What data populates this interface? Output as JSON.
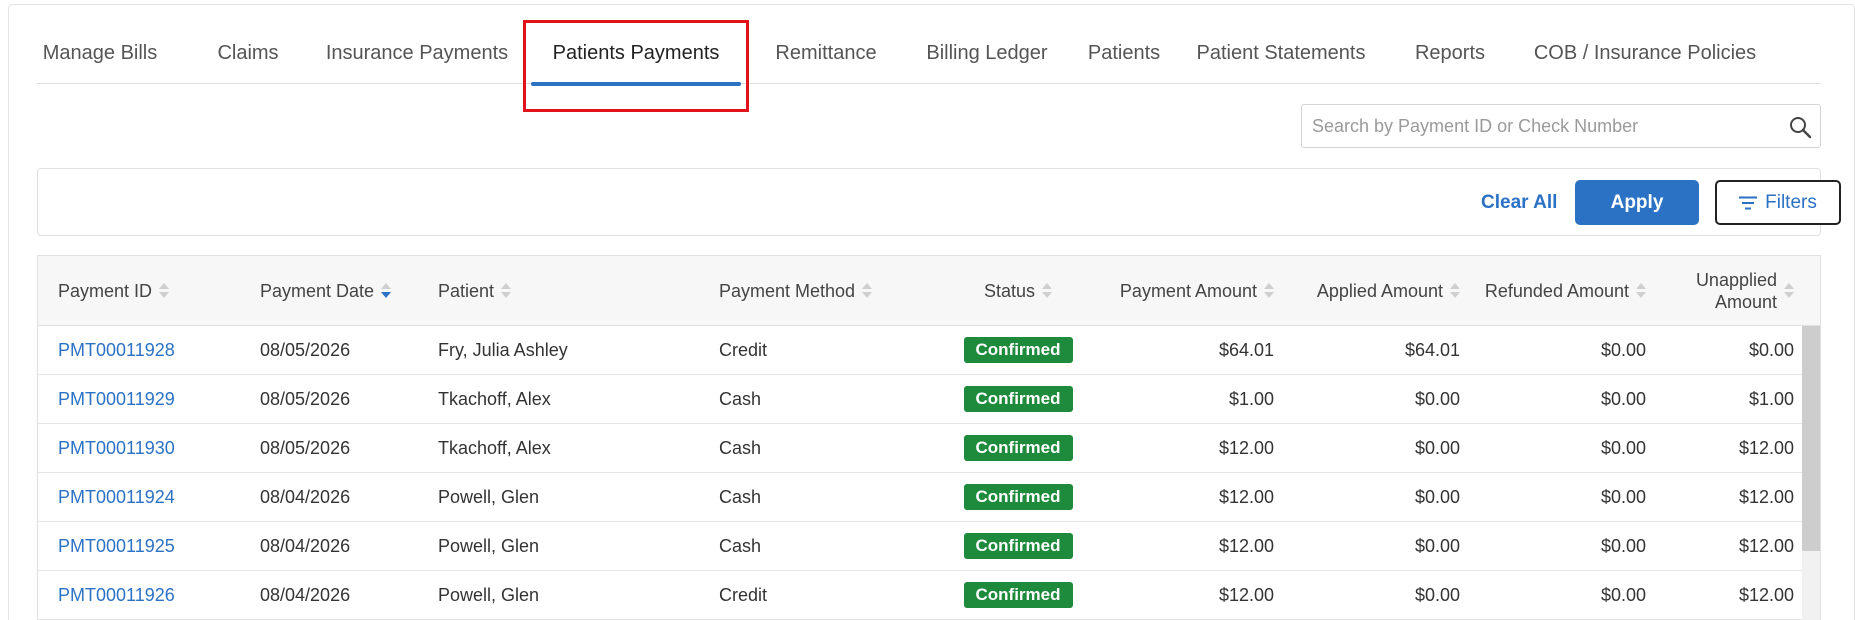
{
  "tabs": [
    {
      "label": "Manage Bills"
    },
    {
      "label": "Claims"
    },
    {
      "label": "Insurance Payments"
    },
    {
      "label": "Patients Payments",
      "active": true
    },
    {
      "label": "Remittance"
    },
    {
      "label": "Billing Ledger"
    },
    {
      "label": "Patients"
    },
    {
      "label": "Patient Statements"
    },
    {
      "label": "Reports"
    },
    {
      "label": "COB / Insurance Policies"
    }
  ],
  "search": {
    "placeholder": "Search by Payment ID or Check Number",
    "value": "",
    "icon": "search-icon"
  },
  "filterbar": {
    "clear_label": "Clear All",
    "apply_label": "Apply",
    "filters_label": "Filters",
    "filters_icon": "filter-lines-icon"
  },
  "table": {
    "columns": [
      {
        "label": "Payment ID",
        "sort": "none"
      },
      {
        "label": "Payment Date",
        "sort": "desc"
      },
      {
        "label": "Patient",
        "sort": "none"
      },
      {
        "label": "Payment Method",
        "sort": "none"
      },
      {
        "label": "Status",
        "sort": "none"
      },
      {
        "label": "Payment Amount",
        "sort": "none"
      },
      {
        "label": "Applied Amount",
        "sort": "none"
      },
      {
        "label": "Refunded Amount",
        "sort": "none"
      },
      {
        "label": "Unapplied Amount",
        "label_line1": "Unapplied",
        "label_line2": "Amount",
        "sort": "none"
      }
    ],
    "rows": [
      {
        "id": "PMT00011928",
        "date": "08/05/2026",
        "patient": "Fry, Julia Ashley",
        "method": "Credit",
        "status": "Confirmed",
        "payment": "$64.01",
        "applied": "$64.01",
        "refunded": "$0.00",
        "unapplied": "$0.00"
      },
      {
        "id": "PMT00011929",
        "date": "08/05/2026",
        "patient": "Tkachoff, Alex",
        "method": "Cash",
        "status": "Confirmed",
        "payment": "$1.00",
        "applied": "$0.00",
        "refunded": "$0.00",
        "unapplied": "$1.00"
      },
      {
        "id": "PMT00011930",
        "date": "08/05/2026",
        "patient": "Tkachoff, Alex",
        "method": "Cash",
        "status": "Confirmed",
        "payment": "$12.00",
        "applied": "$0.00",
        "refunded": "$0.00",
        "unapplied": "$12.00"
      },
      {
        "id": "PMT00011924",
        "date": "08/04/2026",
        "patient": "Powell, Glen",
        "method": "Cash",
        "status": "Confirmed",
        "payment": "$12.00",
        "applied": "$0.00",
        "refunded": "$0.00",
        "unapplied": "$12.00"
      },
      {
        "id": "PMT00011925",
        "date": "08/04/2026",
        "patient": "Powell, Glen",
        "method": "Cash",
        "status": "Confirmed",
        "payment": "$12.00",
        "applied": "$0.00",
        "refunded": "$0.00",
        "unapplied": "$12.00"
      },
      {
        "id": "PMT00011926",
        "date": "08/04/2026",
        "patient": "Powell, Glen",
        "method": "Credit",
        "status": "Confirmed",
        "payment": "$12.00",
        "applied": "$0.00",
        "refunded": "$0.00",
        "unapplied": "$12.00"
      }
    ]
  },
  "colors": {
    "accent": "#2b72c5",
    "status_confirmed": "#1e8a3c",
    "highlight": "#e0131a"
  }
}
